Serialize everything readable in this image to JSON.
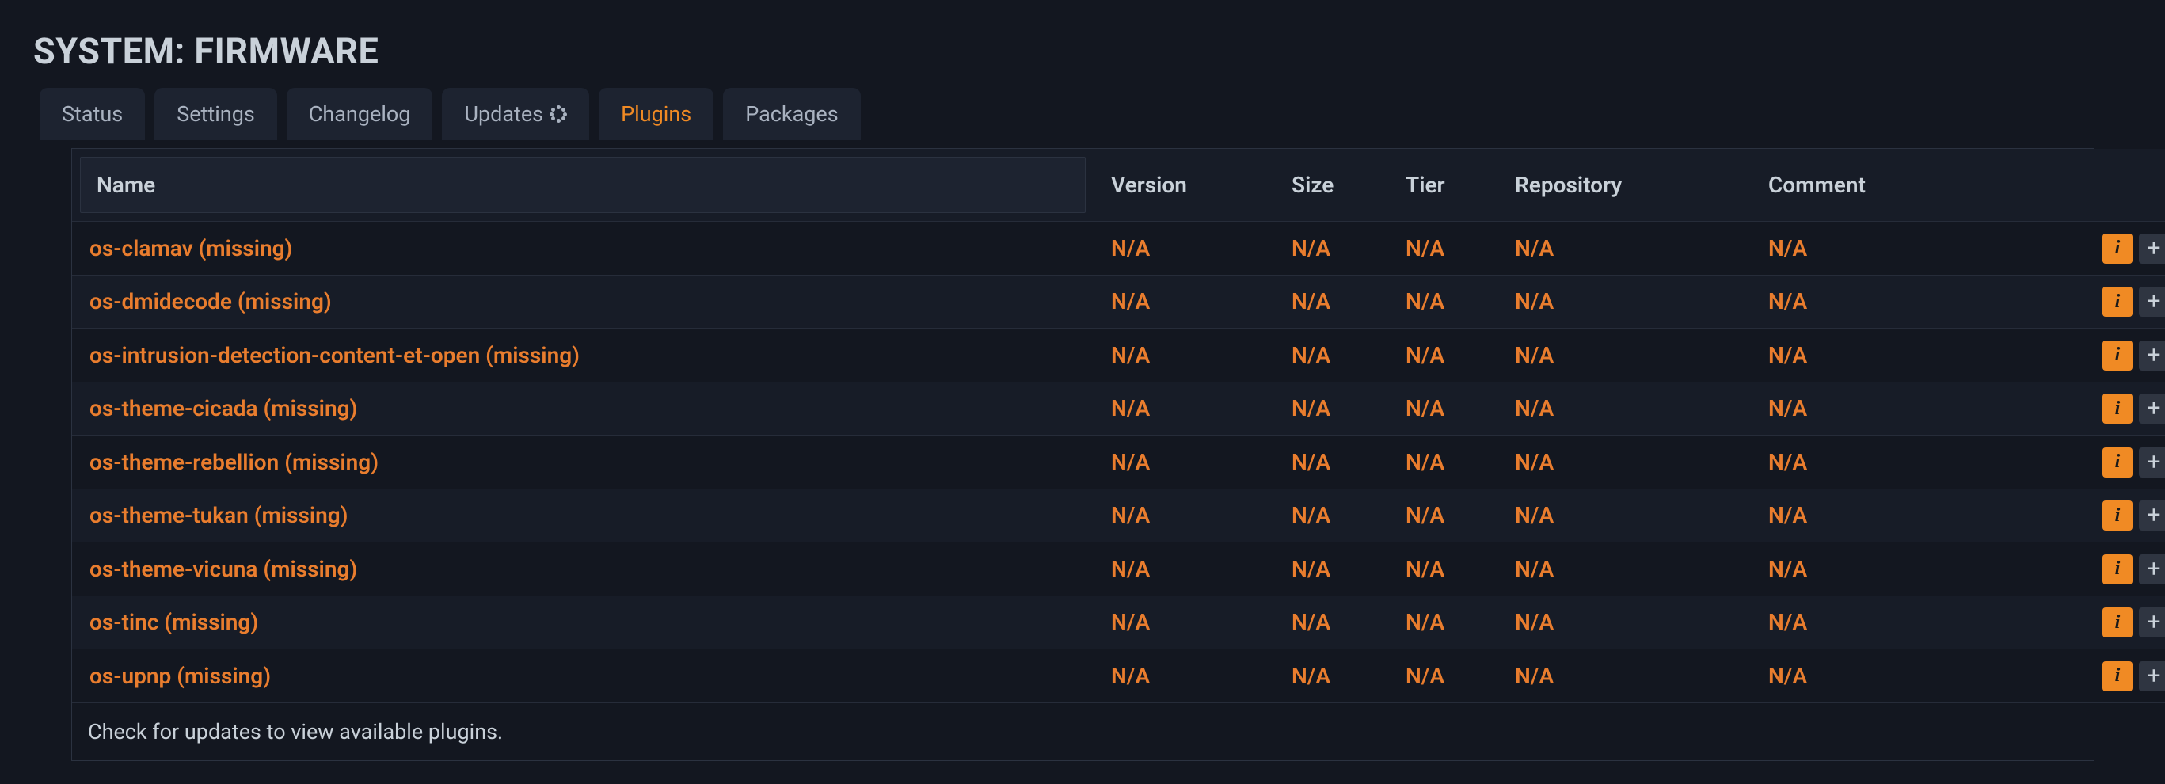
{
  "header": {
    "title": "SYSTEM: FIRMWARE"
  },
  "tabs": {
    "status": {
      "label": "Status"
    },
    "settings": {
      "label": "Settings"
    },
    "changelog": {
      "label": "Changelog"
    },
    "updates": {
      "label": "Updates"
    },
    "plugins": {
      "label": "Plugins"
    },
    "packages": {
      "label": "Packages"
    },
    "active": "plugins"
  },
  "table": {
    "columns": {
      "name": "Name",
      "version": "Version",
      "size": "Size",
      "tier": "Tier",
      "repository": "Repository",
      "comment": "Comment"
    },
    "rows": [
      {
        "name": "os-clamav (missing)",
        "version": "N/A",
        "size": "N/A",
        "tier": "N/A",
        "repository": "N/A",
        "comment": "N/A"
      },
      {
        "name": "os-dmidecode (missing)",
        "version": "N/A",
        "size": "N/A",
        "tier": "N/A",
        "repository": "N/A",
        "comment": "N/A"
      },
      {
        "name": "os-intrusion-detection-content-et-open (missing)",
        "version": "N/A",
        "size": "N/A",
        "tier": "N/A",
        "repository": "N/A",
        "comment": "N/A"
      },
      {
        "name": "os-theme-cicada (missing)",
        "version": "N/A",
        "size": "N/A",
        "tier": "N/A",
        "repository": "N/A",
        "comment": "N/A"
      },
      {
        "name": "os-theme-rebellion (missing)",
        "version": "N/A",
        "size": "N/A",
        "tier": "N/A",
        "repository": "N/A",
        "comment": "N/A"
      },
      {
        "name": "os-theme-tukan (missing)",
        "version": "N/A",
        "size": "N/A",
        "tier": "N/A",
        "repository": "N/A",
        "comment": "N/A"
      },
      {
        "name": "os-theme-vicuna (missing)",
        "version": "N/A",
        "size": "N/A",
        "tier": "N/A",
        "repository": "N/A",
        "comment": "N/A"
      },
      {
        "name": "os-tinc (missing)",
        "version": "N/A",
        "size": "N/A",
        "tier": "N/A",
        "repository": "N/A",
        "comment": "N/A"
      },
      {
        "name": "os-upnp (missing)",
        "version": "N/A",
        "size": "N/A",
        "tier": "N/A",
        "repository": "N/A",
        "comment": "N/A"
      }
    ],
    "footer_note": "Check for updates to view available plugins."
  },
  "icons": {
    "info_glyph": "i",
    "add_glyph": "+"
  }
}
